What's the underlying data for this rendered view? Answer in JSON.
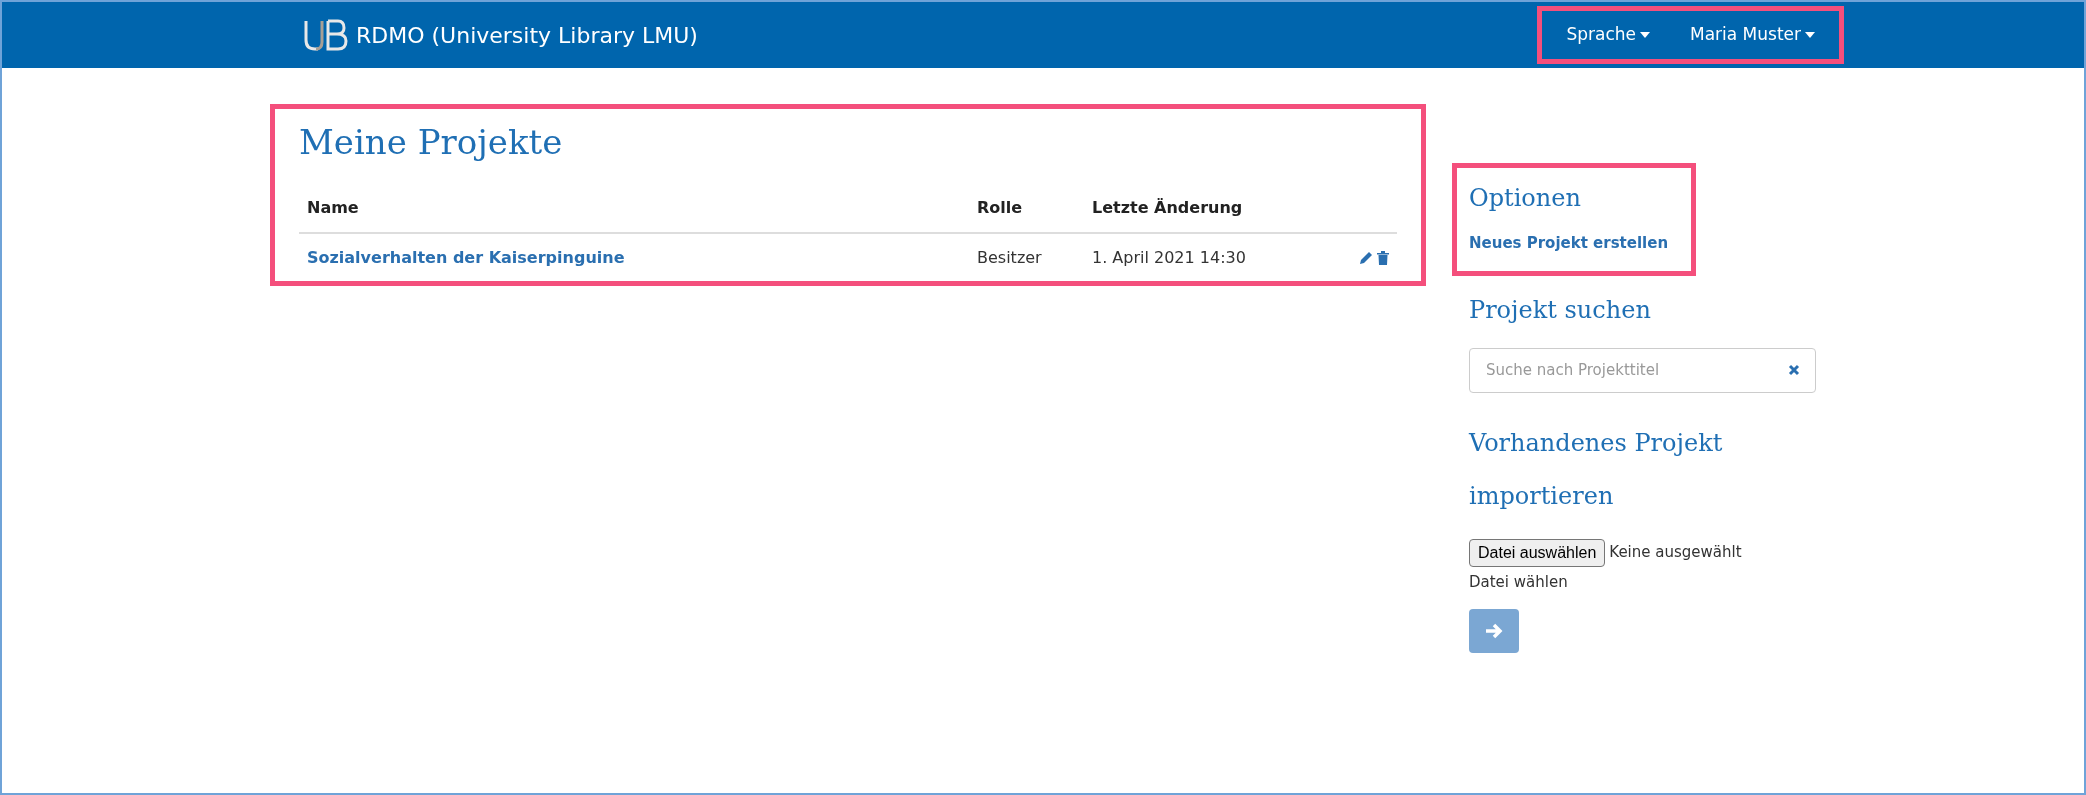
{
  "navbar": {
    "brand": "RDMO (University Library LMU)",
    "menus": [
      {
        "label": "Sprache"
      },
      {
        "label": "Maria Muster"
      }
    ]
  },
  "projects": {
    "title": "Meine Projekte",
    "columns": [
      "Name",
      "Rolle",
      "Letzte Änderung"
    ],
    "rows": [
      {
        "name": "Sozialverhalten der Kaiserpinguine",
        "role": "Besitzer",
        "updated": "1. April 2021 14:30"
      }
    ]
  },
  "sidebar": {
    "options_title": "Optionen",
    "create_link": "Neues Projekt erstellen",
    "search_title": "Projekt suchen",
    "search": {
      "placeholder": "Suche nach Projekttitel"
    },
    "import_title": "Vorhandenes Projekt importieren",
    "file_button": "Datei auswählen",
    "file_status": "Keine ausgewählt",
    "file_hint": "Datei wählen",
    "submit": {
      "disabled": true
    }
  }
}
